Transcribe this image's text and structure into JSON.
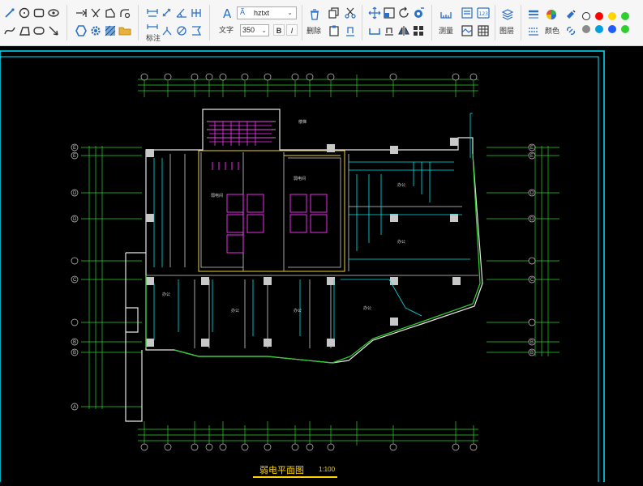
{
  "toolbar": {
    "font_name": "hztxt",
    "font_size": "350",
    "bold": "B",
    "italic": "I",
    "groups": {
      "annotate": "标注",
      "text": "文字",
      "delete": "删除",
      "measure": "测量",
      "layers": "图层",
      "color": "颜色"
    },
    "swatch_colors": [
      "#ffffff",
      "#ff0000",
      "#ffd500",
      "#2fcf2f",
      "#8a8a8a",
      "#00a0e0",
      "#1e5cff",
      "#2fcf2f"
    ]
  },
  "drawing": {
    "title": "弱电平面图",
    "scale": "1:100",
    "row_axes": [
      "E",
      "E",
      "D",
      "D",
      "C",
      "B",
      "B",
      "A"
    ],
    "colors": {
      "background": "#000000",
      "frame": "#00e5ff",
      "walls": "#ffffff",
      "cable": "#00e5e5",
      "dimension": "#2fd02f",
      "equipment": "#ff33ff",
      "title": "#ffd400"
    }
  }
}
